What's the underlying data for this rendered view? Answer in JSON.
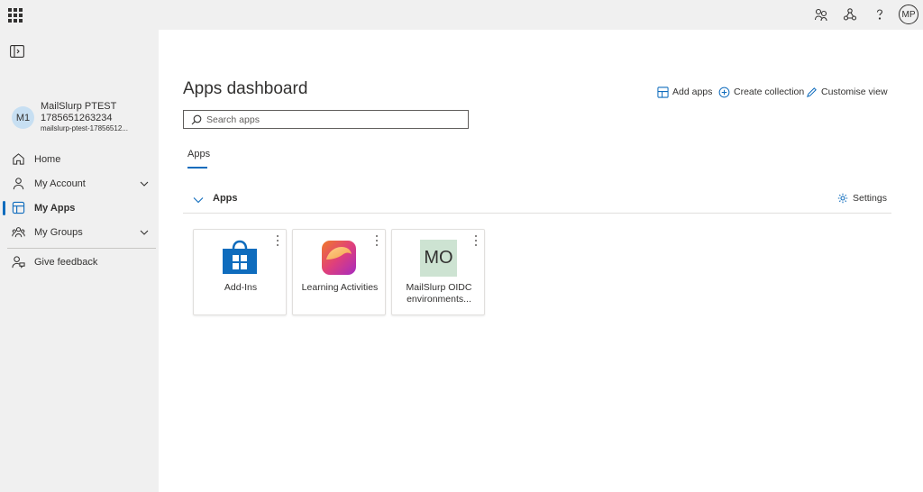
{
  "header": {
    "me_initials": "MP"
  },
  "profile": {
    "avatar_initials": "M1",
    "name": "MailSlurp PTEST 1785651263234",
    "email": "mailslurp-ptest-17856512..."
  },
  "nav": {
    "items": [
      {
        "label": "Home"
      },
      {
        "label": "My Account"
      },
      {
        "label": "My Apps"
      },
      {
        "label": "My Groups"
      },
      {
        "label": "Give feedback"
      }
    ]
  },
  "main": {
    "title": "Apps dashboard",
    "toolbar": {
      "add_apps": "Add apps",
      "create_collection": "Create collection",
      "customise_view": "Customise view"
    },
    "search": {
      "placeholder": "Search apps",
      "value": ""
    },
    "tabs": [
      {
        "label": "Apps",
        "selected": true
      }
    ],
    "group": {
      "title": "Apps",
      "settings_label": "Settings"
    },
    "apps": [
      {
        "name": "Add-Ins",
        "icon": "shopping-bag-icon"
      },
      {
        "name": "Learning Activities",
        "icon": "learning-activities-icon"
      },
      {
        "name": "MailSlurp OIDC environments...",
        "initials": "MO"
      }
    ]
  },
  "colors": {
    "accent": "#0f6cbd",
    "sidebar_bg": "#f0f0f0"
  }
}
